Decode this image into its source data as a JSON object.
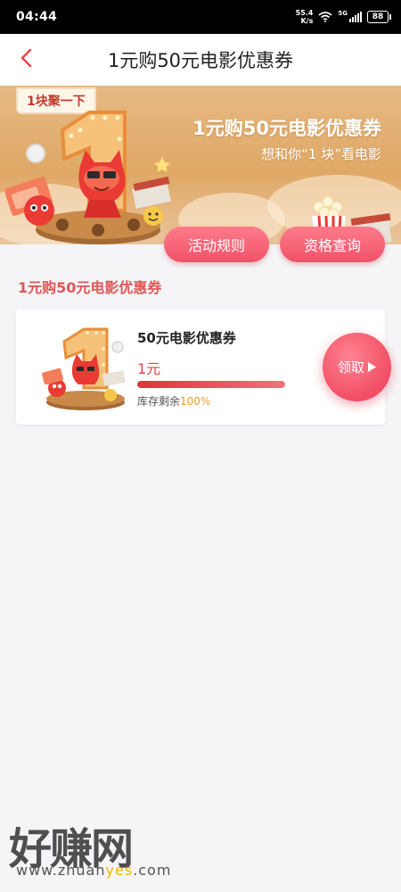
{
  "status_bar": {
    "time": "04:44",
    "net_speed_value": "55.4",
    "net_speed_unit": "K/s",
    "signal_label": "5G",
    "battery": "88"
  },
  "header": {
    "title": "1元购50元电影优惠券",
    "back_icon": "chevron-left-icon"
  },
  "banner": {
    "tag": "1块聚一下",
    "title": "1元购50元电影优惠券",
    "subtitle": "想和你“1 块”看电影",
    "rules_button": "活动规则",
    "eligibility_button": "资格查询"
  },
  "section": {
    "title": "1元购50元电影优惠券"
  },
  "coupon": {
    "name": "50元电影优惠券",
    "price": "1元",
    "stock_label": "库存剩余",
    "stock_value": "100%",
    "stock_fraction": 1.0,
    "claim_button": "领取"
  },
  "watermark": {
    "main": "好赚网",
    "url_prefix": "www.zhuan",
    "url_highlight": "yes",
    "url_suffix": ".com"
  },
  "colors": {
    "accent": "#e8434b",
    "section_title": "#e05555",
    "button_pink": "#f0536a",
    "stock_orange": "#f09a2a"
  }
}
